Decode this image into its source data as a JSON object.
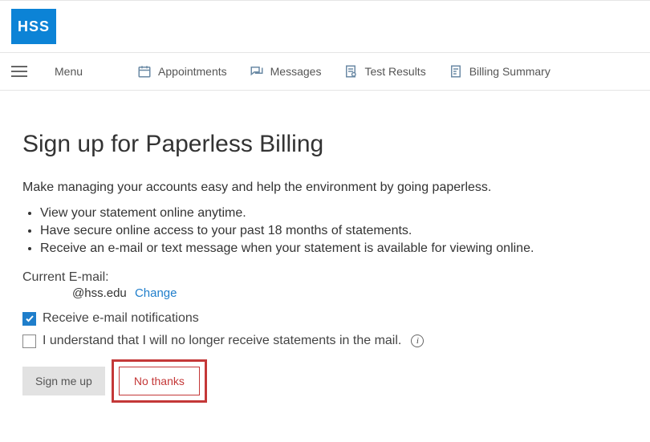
{
  "logo": {
    "text": "HSS"
  },
  "nav": {
    "menu_label": "Menu",
    "items": [
      {
        "label": "Appointments"
      },
      {
        "label": "Messages"
      },
      {
        "label": "Test Results"
      },
      {
        "label": "Billing Summary"
      }
    ]
  },
  "page": {
    "heading": "Sign up for Paperless Billing",
    "intro": "Make managing your accounts easy and help the environment by going paperless.",
    "bullets": [
      "View your statement online anytime.",
      "Have secure online access to your past 18 months of statements.",
      "Receive an e-mail or text message when your statement is available for viewing online."
    ],
    "email_label": "Current E-mail:",
    "email_value": "@hss.edu",
    "change_label": "Change",
    "checkbox_notifications": "Receive e-mail notifications",
    "checkbox_understand": "I understand that I will no longer receive statements in the mail.",
    "info_char": "i",
    "btn_signup": "Sign me up",
    "btn_nothanks": "No thanks"
  }
}
